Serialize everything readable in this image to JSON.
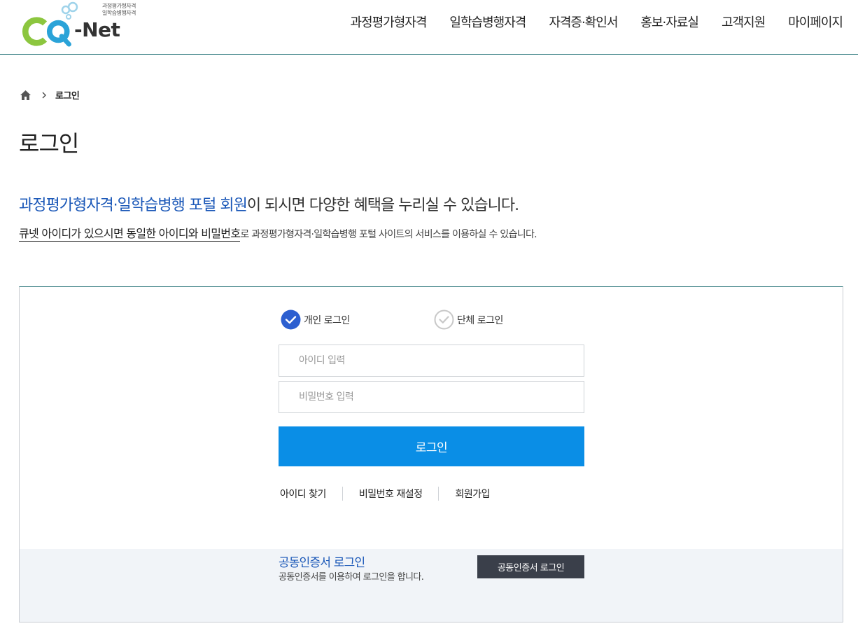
{
  "header": {
    "logo_sub_line1": "과정평가형자격",
    "logo_sub_line2": "일학습병행자격",
    "logo_text": "-Net",
    "nav": [
      "과정평가형자격",
      "일학습병행자격",
      "자격증·확인서",
      "홍보·자료실",
      "고객지원",
      "마이페이지"
    ]
  },
  "breadcrumb": {
    "current": "로그인"
  },
  "page_title": "로그인",
  "intro": {
    "highlight": "과정평가형자격·일학습병행 포털 회원",
    "rest": "이 되시면 다양한 혜택을 누리실 수 있습니다.",
    "sub_underlined": "큐넷 아이디가 있으시면 동일한 아이디와 비밀번호",
    "sub_rest": "로 과정평가형자격·일학습병행 포털 사이트의 서비스를 이용하실 수 있습니다."
  },
  "login": {
    "type_personal": "개인 로그인",
    "type_group": "단체 로그인",
    "selected_type": "personal",
    "id_placeholder": "아이디 입력",
    "pw_placeholder": "비밀번호 입력",
    "login_button": "로그인",
    "links": {
      "find_id": "아이디 찾기",
      "reset_pw": "비밀번호 재설정",
      "signup": "회원가입"
    }
  },
  "cert": {
    "title": "공동인증서 로그인",
    "desc": "공동인증서를 이용하여 로그인을 합니다.",
    "button": "공동인증서 로그인"
  },
  "colors": {
    "accent_blue": "#0a8ee6",
    "highlight_text": "#1b58b8",
    "dark_button": "#3a3f4a",
    "logo_green": "#8cc63f",
    "logo_blue": "#2aa3d8"
  }
}
